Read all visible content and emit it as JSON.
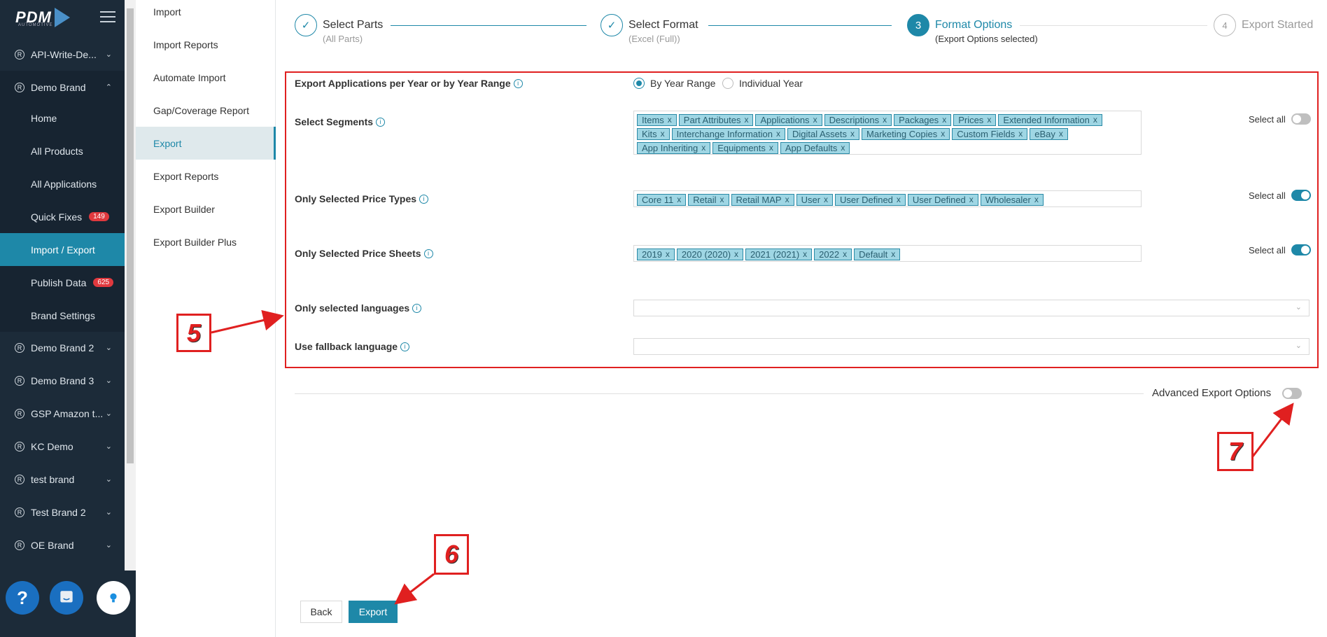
{
  "brand": {
    "logo_text": "PDM",
    "logo_sub": "AUTOMOTIVE"
  },
  "sidebar": {
    "items": [
      {
        "label": "API-Write-De..."
      },
      {
        "label": "Demo Brand"
      },
      {
        "label": "Demo Brand 2"
      },
      {
        "label": "Demo Brand 3"
      },
      {
        "label": "GSP Amazon t..."
      },
      {
        "label": "KC Demo"
      },
      {
        "label": "test brand"
      },
      {
        "label": "Test Brand 2"
      },
      {
        "label": "OE Brand"
      }
    ],
    "sub_items": [
      {
        "label": "Home"
      },
      {
        "label": "All Products"
      },
      {
        "label": "All Applications"
      },
      {
        "label": "Quick Fixes",
        "badge": "149"
      },
      {
        "label": "Import / Export"
      },
      {
        "label": "Publish Data",
        "badge": "625"
      },
      {
        "label": "Brand Settings"
      }
    ],
    "help_label": "?"
  },
  "submenu": {
    "items": [
      {
        "label": "Import"
      },
      {
        "label": "Import Reports"
      },
      {
        "label": "Automate Import"
      },
      {
        "label": "Gap/Coverage Report"
      },
      {
        "label": "Export"
      },
      {
        "label": "Export Reports"
      },
      {
        "label": "Export Builder"
      },
      {
        "label": "Export Builder Plus"
      }
    ]
  },
  "steps": [
    {
      "title": "Select Parts",
      "sub": "(All Parts)"
    },
    {
      "title": "Select Format",
      "sub": "(Excel (Full))"
    },
    {
      "number": "3",
      "title": "Format Options",
      "sub": "(Export Options selected)"
    },
    {
      "number": "4",
      "title": "Export Started"
    }
  ],
  "form": {
    "year_range": {
      "label": "Export Applications per Year or by Year Range",
      "option1": "By Year Range",
      "option2": "Individual Year"
    },
    "segments": {
      "label": "Select Segments",
      "tags": [
        "Items",
        "Part Attributes",
        "Applications",
        "Descriptions",
        "Packages",
        "Prices",
        "Extended Information",
        "Kits",
        "Interchange Information",
        "Digital Assets",
        "Marketing Copies",
        "Custom Fields",
        "eBay",
        "App Inheriting",
        "Equipments",
        "App Defaults"
      ],
      "select_all": "Select all"
    },
    "price_types": {
      "label": "Only Selected Price Types",
      "tags": [
        "Core 11",
        "Retail",
        "Retail MAP",
        "User",
        "User Defined",
        "User Defined",
        "Wholesaler"
      ],
      "select_all": "Select all"
    },
    "price_sheets": {
      "label": "Only Selected Price Sheets",
      "tags": [
        "2019",
        "2020 (2020)",
        "2021 (2021)",
        "2022",
        "Default"
      ],
      "select_all": "Select all"
    },
    "languages": {
      "label": "Only selected languages"
    },
    "fallback": {
      "label": "Use fallback language"
    },
    "advanced": "Advanced Export Options"
  },
  "buttons": {
    "back": "Back",
    "export": "Export"
  },
  "callouts": {
    "c5": "5",
    "c6": "6",
    "c7": "7"
  },
  "colors": {
    "accent": "#1e88a8",
    "sidebar_bg": "#1c2b39",
    "annotation": "#e02020"
  }
}
